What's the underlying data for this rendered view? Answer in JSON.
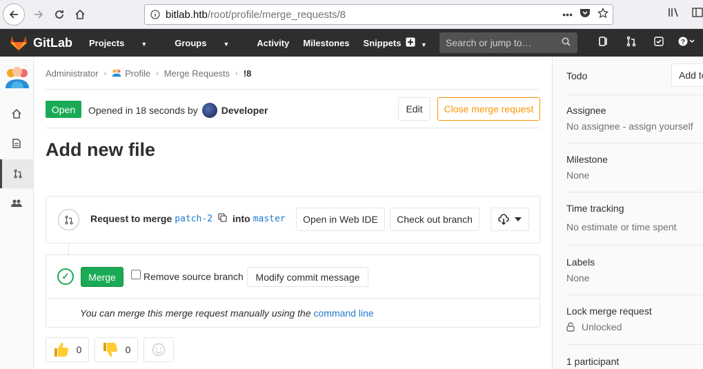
{
  "browser": {
    "url_host": "bitlab.htb",
    "url_path": "/root/profile/merge_requests/8"
  },
  "header": {
    "brand": "GitLab",
    "nav": [
      "Projects",
      "Groups",
      "Activity",
      "Milestones",
      "Snippets"
    ],
    "search_placeholder": "Search or jump to…"
  },
  "breadcrumb": {
    "items": [
      "Administrator",
      "Profile",
      "Merge Requests"
    ],
    "current": "!8"
  },
  "mr": {
    "status": "Open",
    "opened_text": "Opened in 18 seconds by",
    "author": "Developer",
    "edit_label": "Edit",
    "close_label": "Close merge request",
    "title": "Add new file"
  },
  "widget": {
    "request_prefix": "Request to merge",
    "source_branch": "patch-2",
    "into_text": "into",
    "target_branch": "master",
    "webide_label": "Open in Web IDE",
    "checkout_label": "Check out branch",
    "merge_label": "Merge",
    "remove_source_label": "Remove source branch",
    "modify_commit_label": "Modify commit message",
    "manual_note": "You can merge this merge request manually using the",
    "command_line_link": "command line"
  },
  "awards": {
    "thumbsup_count": "0",
    "thumbsdown_count": "0"
  },
  "sidebar": {
    "todo_label": "Todo",
    "add_todo_label": "Add todo",
    "assignee_title": "Assignee",
    "assignee_value": "No assignee - assign yourself",
    "milestone_title": "Milestone",
    "milestone_value": "None",
    "time_tracking_title": "Time tracking",
    "time_tracking_value": "No estimate or time spent",
    "labels_title": "Labels",
    "labels_value": "None",
    "lock_title": "Lock merge request",
    "lock_value": "Unlocked",
    "participants": "1 participant"
  },
  "colors": {
    "open_green": "#1aaa55",
    "close_orange": "#fc9403",
    "link_blue": "#1f78d1"
  }
}
